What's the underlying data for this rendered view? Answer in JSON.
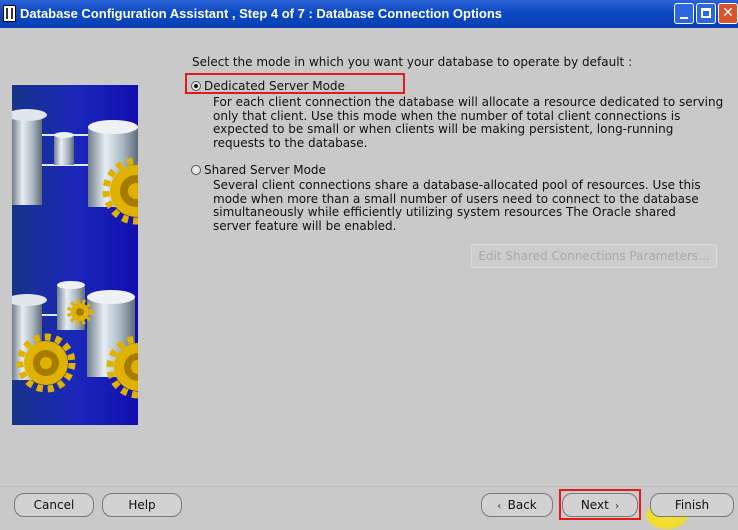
{
  "window": {
    "title": "Database Configuration Assistant , Step 4 of 7 : Database Connection Options"
  },
  "content": {
    "prompt": "Select the mode in which you want your database to operate by default :",
    "dedicated": {
      "label": "Dedicated Server Mode",
      "checked": true,
      "description": [
        "For each client connection the database will allocate a resource dedicated to serving",
        "only that client.  Use this mode when the number of total client connections is",
        "expected to be small or when clients will be making persistent, long-running",
        "requests to the database."
      ]
    },
    "shared": {
      "label": "Shared Server Mode",
      "checked": false,
      "description": [
        "Several client connections share a database-allocated pool of resources.  Use this",
        "mode when more than a small number of users need to connect to the database",
        "simultaneously while efficiently utilizing system resources  The Oracle shared",
        "server feature will be enabled."
      ]
    },
    "edit_button": "Edit Shared Connections Parameters..."
  },
  "footer": {
    "cancel": "Cancel",
    "help": "Help",
    "back": "Back",
    "next": "Next",
    "finish": "Finish"
  },
  "colors": {
    "titlebar": "#0b4ac4",
    "background": "#c9c9c9",
    "highlight": "#e01b1b",
    "illustration": "#1a27b9"
  }
}
